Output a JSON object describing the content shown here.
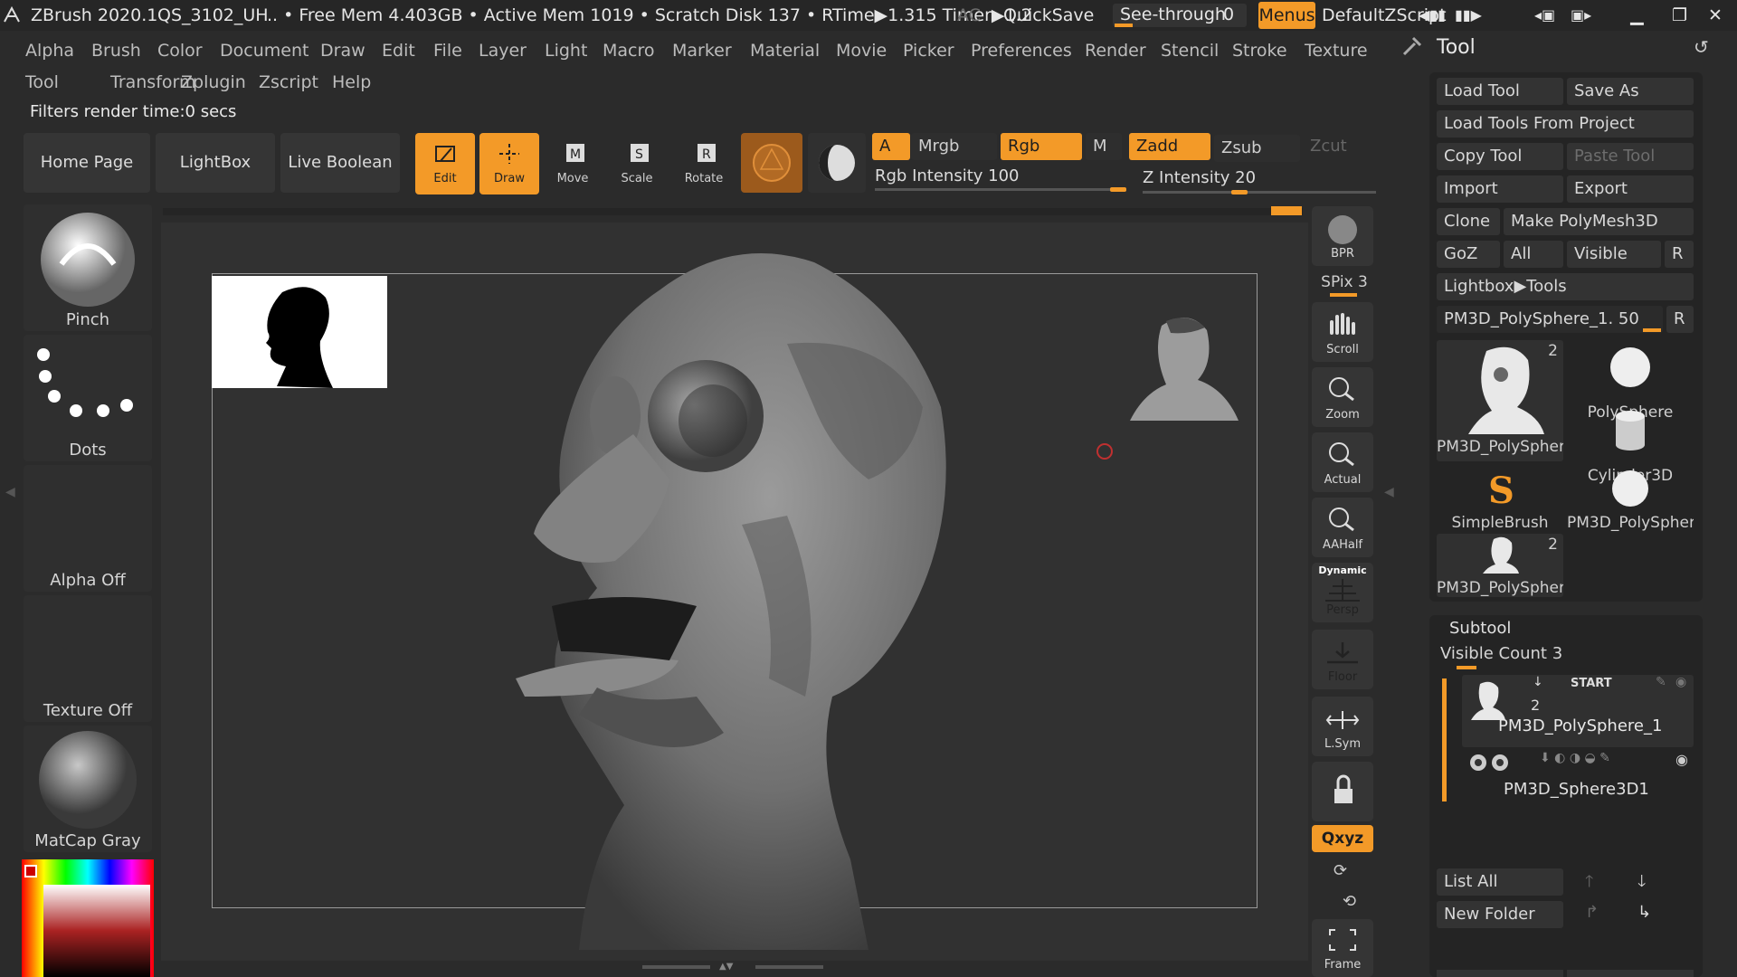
{
  "title_bar": {
    "app": "ZBrush 2020.1",
    "file": "QS_3102_UH",
    "status": ".. • Free Mem 4.403GB • Active Mem 1019 • Scratch Disk 137 • RTime▶1.315 Timer▶1.2",
    "ac": "AC",
    "quicksave": "QuickSave",
    "see_through": "See-through",
    "see_through_value": "0",
    "menus": "Menus",
    "zscript": "DefaultZScript"
  },
  "menu": {
    "row1": [
      "Alpha",
      "Brush",
      "Color",
      "Document",
      "Draw",
      "Edit",
      "File",
      "Layer",
      "Light",
      "Macro",
      "Marker",
      "Material",
      "Movie",
      "Picker",
      "Preferences",
      "Render",
      "Stencil",
      "Stroke",
      "Texture"
    ],
    "row2": [
      "Tool",
      "Transform",
      "Zplugin",
      "Zscript",
      "Help"
    ]
  },
  "status": "Filters render time:0 secs",
  "toolbar": {
    "home": "Home Page",
    "lightbox": "LightBox",
    "live_boolean": "Live Boolean",
    "edit": "Edit",
    "draw": "Draw",
    "move": "Move",
    "scale": "Scale",
    "rotate": "Rotate",
    "a": "A",
    "mrgb": "Mrgb",
    "rgb": "Rgb",
    "m": "M",
    "zadd": "Zadd",
    "zsub": "Zsub",
    "zcut": "Zcut",
    "rgb_intensity": "Rgb Intensity 100",
    "z_intensity": "Z Intensity 20",
    "rgb_intensity_value": 1.0,
    "z_intensity_value": 0.2
  },
  "left": {
    "brush": "Pinch",
    "stroke": "Dots",
    "alpha": "Alpha Off",
    "texture": "Texture Off",
    "material": "MatCap Gray"
  },
  "shelf": {
    "bpr": "BPR",
    "spix": "SPix 3",
    "scroll": "Scroll",
    "zoom": "Zoom",
    "actual": "Actual",
    "aahalf": "AAHalf",
    "dynamic": "Dynamic",
    "persp": "Persp",
    "floor": "Floor",
    "lsym": "L.Sym",
    "xyz": "Qxyz",
    "frame": "Frame"
  },
  "tool_panel": {
    "title": "Tool",
    "load_tool": "Load Tool",
    "save_as": "Save As",
    "load_from_project": "Load Tools From Project",
    "copy_tool": "Copy Tool",
    "paste_tool": "Paste Tool",
    "import": "Import",
    "export": "Export",
    "clone": "Clone",
    "make_polymesh": "Make PolyMesh3D",
    "goz": "GoZ",
    "all": "All",
    "visible": "Visible",
    "r": "R",
    "lightbox_tools": "Lightbox▶Tools",
    "current_tool": "PM3D_PolySphere_1. 50",
    "thumbs": [
      "PM3D_PolySpher",
      "PolySphere",
      "Cylinder3D",
      "SimpleBrush",
      "PM3D_PolySpher",
      "PM3D_PolySpher"
    ],
    "badge": "2"
  },
  "subtool": {
    "title": "Subtool",
    "visible_count": "Visible Count 3",
    "start": "START",
    "count": "2",
    "item1": "PM3D_PolySphere_1",
    "item2": "PM3D_Sphere3D1",
    "list_all": "List All",
    "new_folder": "New Folder"
  }
}
